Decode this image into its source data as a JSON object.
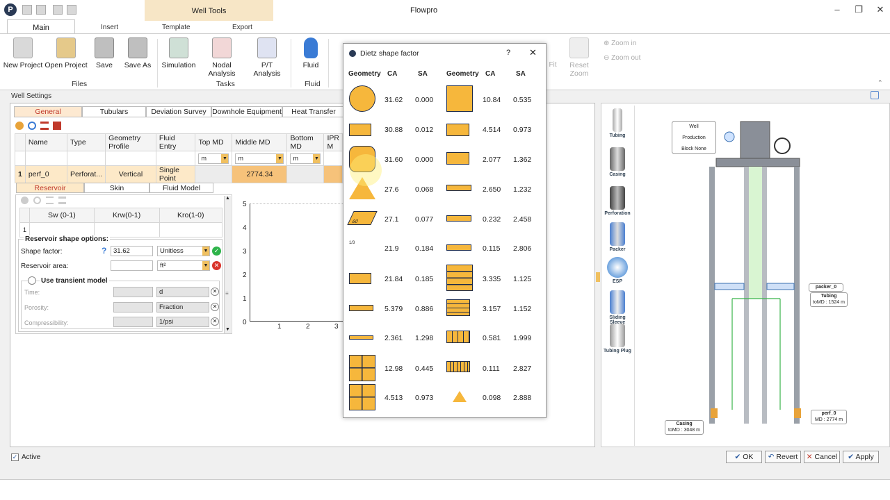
{
  "app": {
    "title": "Flowpro",
    "context_tab": "Well Tools"
  },
  "ribbon": {
    "tabs": [
      "Main",
      "Insert",
      "Template",
      "Export"
    ],
    "buttons": {
      "new_project": "New Project",
      "open_project": "Open Project",
      "save": "Save",
      "save_as": "Save As",
      "simulation": "Simulation",
      "nodal_analysis": "Nodal Analysis",
      "pt_analysis": "P/T Analysis",
      "fluid": "Fluid",
      "fit": "Fit",
      "reset_zoom": "Reset Zoom",
      "zoom_in": "Zoom in",
      "zoom_out": "Zoom out"
    },
    "groups": {
      "files": "Files",
      "tasks": "Tasks",
      "fluid": "Fluid"
    }
  },
  "well_settings": {
    "label": "Well Settings",
    "tabs": [
      "General",
      "Tubulars",
      "Deviation Survey",
      "Downhole Equipment",
      "Heat Transfer"
    ],
    "columns": [
      "Name",
      "Type",
      "Geometry Profile",
      "Fluid Entry",
      "Top MD",
      "Middle MD",
      "Bottom MD",
      "IPR M"
    ],
    "units": [
      "m",
      "m",
      "m"
    ],
    "row": {
      "index": "1",
      "name": "perf_0",
      "type": "Perforat...",
      "geometry": "Vertical",
      "fluid_entry": "Single Point",
      "middle_md": "2774.34"
    },
    "subtabs": [
      "Reservoir",
      "Skin",
      "Fluid Model"
    ],
    "rel_perm_cols": [
      "Sw (0-1)",
      "Krw(0-1)",
      "Kro(1-0)"
    ],
    "rel_perm_row": "1",
    "shape_options": {
      "title": "Reservoir shape options:",
      "shape_factor_label": "Shape factor:",
      "shape_factor_value": "31.62",
      "shape_factor_unit": "Unitless",
      "area_label": "Reservoir area:",
      "area_unit": "ft²"
    },
    "transient": {
      "title": "Use transient model",
      "time_label": "Time:",
      "time_unit": "d",
      "porosity_label": "Porosity:",
      "porosity_unit": "Fraction",
      "compress_label": "Compressibility:",
      "compress_unit": "1/psi"
    },
    "plot": {
      "y_ticks": [
        "5",
        "4",
        "3",
        "2",
        "1",
        "0"
      ],
      "x_ticks": [
        "1",
        "2",
        "3"
      ]
    }
  },
  "dialog": {
    "title": "Dietz shape factor",
    "help": "?",
    "headers": {
      "geometry": "Geometry",
      "ca": "CA",
      "sa": "SA"
    },
    "left": [
      {
        "ca": "31.62",
        "sa": "0.000"
      },
      {
        "ca": "30.88",
        "sa": "0.012"
      },
      {
        "ca": "31.60",
        "sa": "0.000"
      },
      {
        "ca": "27.6",
        "sa": "0.068"
      },
      {
        "ca": "27.1",
        "sa": "0.077"
      },
      {
        "ca": "21.9",
        "sa": "0.184"
      },
      {
        "ca": "21.84",
        "sa": "0.185"
      },
      {
        "ca": "5.379",
        "sa": "0.886"
      },
      {
        "ca": "2.361",
        "sa": "1.298"
      },
      {
        "ca": "12.98",
        "sa": "0.445"
      },
      {
        "ca": "4.513",
        "sa": "0.973"
      }
    ],
    "right": [
      {
        "ca": "10.84",
        "sa": "0.535"
      },
      {
        "ca": "4.514",
        "sa": "0.973"
      },
      {
        "ca": "2.077",
        "sa": "1.362"
      },
      {
        "ca": "2.650",
        "sa": "1.232"
      },
      {
        "ca": "0.232",
        "sa": "2.458"
      },
      {
        "ca": "0.115",
        "sa": "2.806"
      },
      {
        "ca": "3.335",
        "sa": "1.125"
      },
      {
        "ca": "3.157",
        "sa": "1.152"
      },
      {
        "ca": "0.581",
        "sa": "1.999"
      },
      {
        "ca": "0.111",
        "sa": "2.827"
      },
      {
        "ca": "0.098",
        "sa": "2.888"
      }
    ],
    "shape_labels": {
      "sixty": "60",
      "ratio": "1/3"
    }
  },
  "palette": [
    "Tubing",
    "Casing",
    "Perforation",
    "Packer",
    "ESP",
    "Sliding Sleeve",
    "Tubing Plug"
  ],
  "schematic": {
    "info_box": [
      "Well",
      "Production",
      "Block None"
    ],
    "labels": {
      "packer": "packer_0",
      "tubing": "Tubing",
      "tubing_md": "toMD : 1524 m",
      "perf": "perf_0",
      "perf_md": "MD : 2774 m",
      "casing": "Casing",
      "casing_md": "toMD : 3048 m"
    }
  },
  "bottom": {
    "active": "Active",
    "ok": "OK",
    "revert": "Revert",
    "cancel": "Cancel",
    "apply": "Apply"
  },
  "colors": {
    "accent_orange": "#f6b73c",
    "navy": "#1e2b4a",
    "selected_tab": "#c0392b"
  }
}
